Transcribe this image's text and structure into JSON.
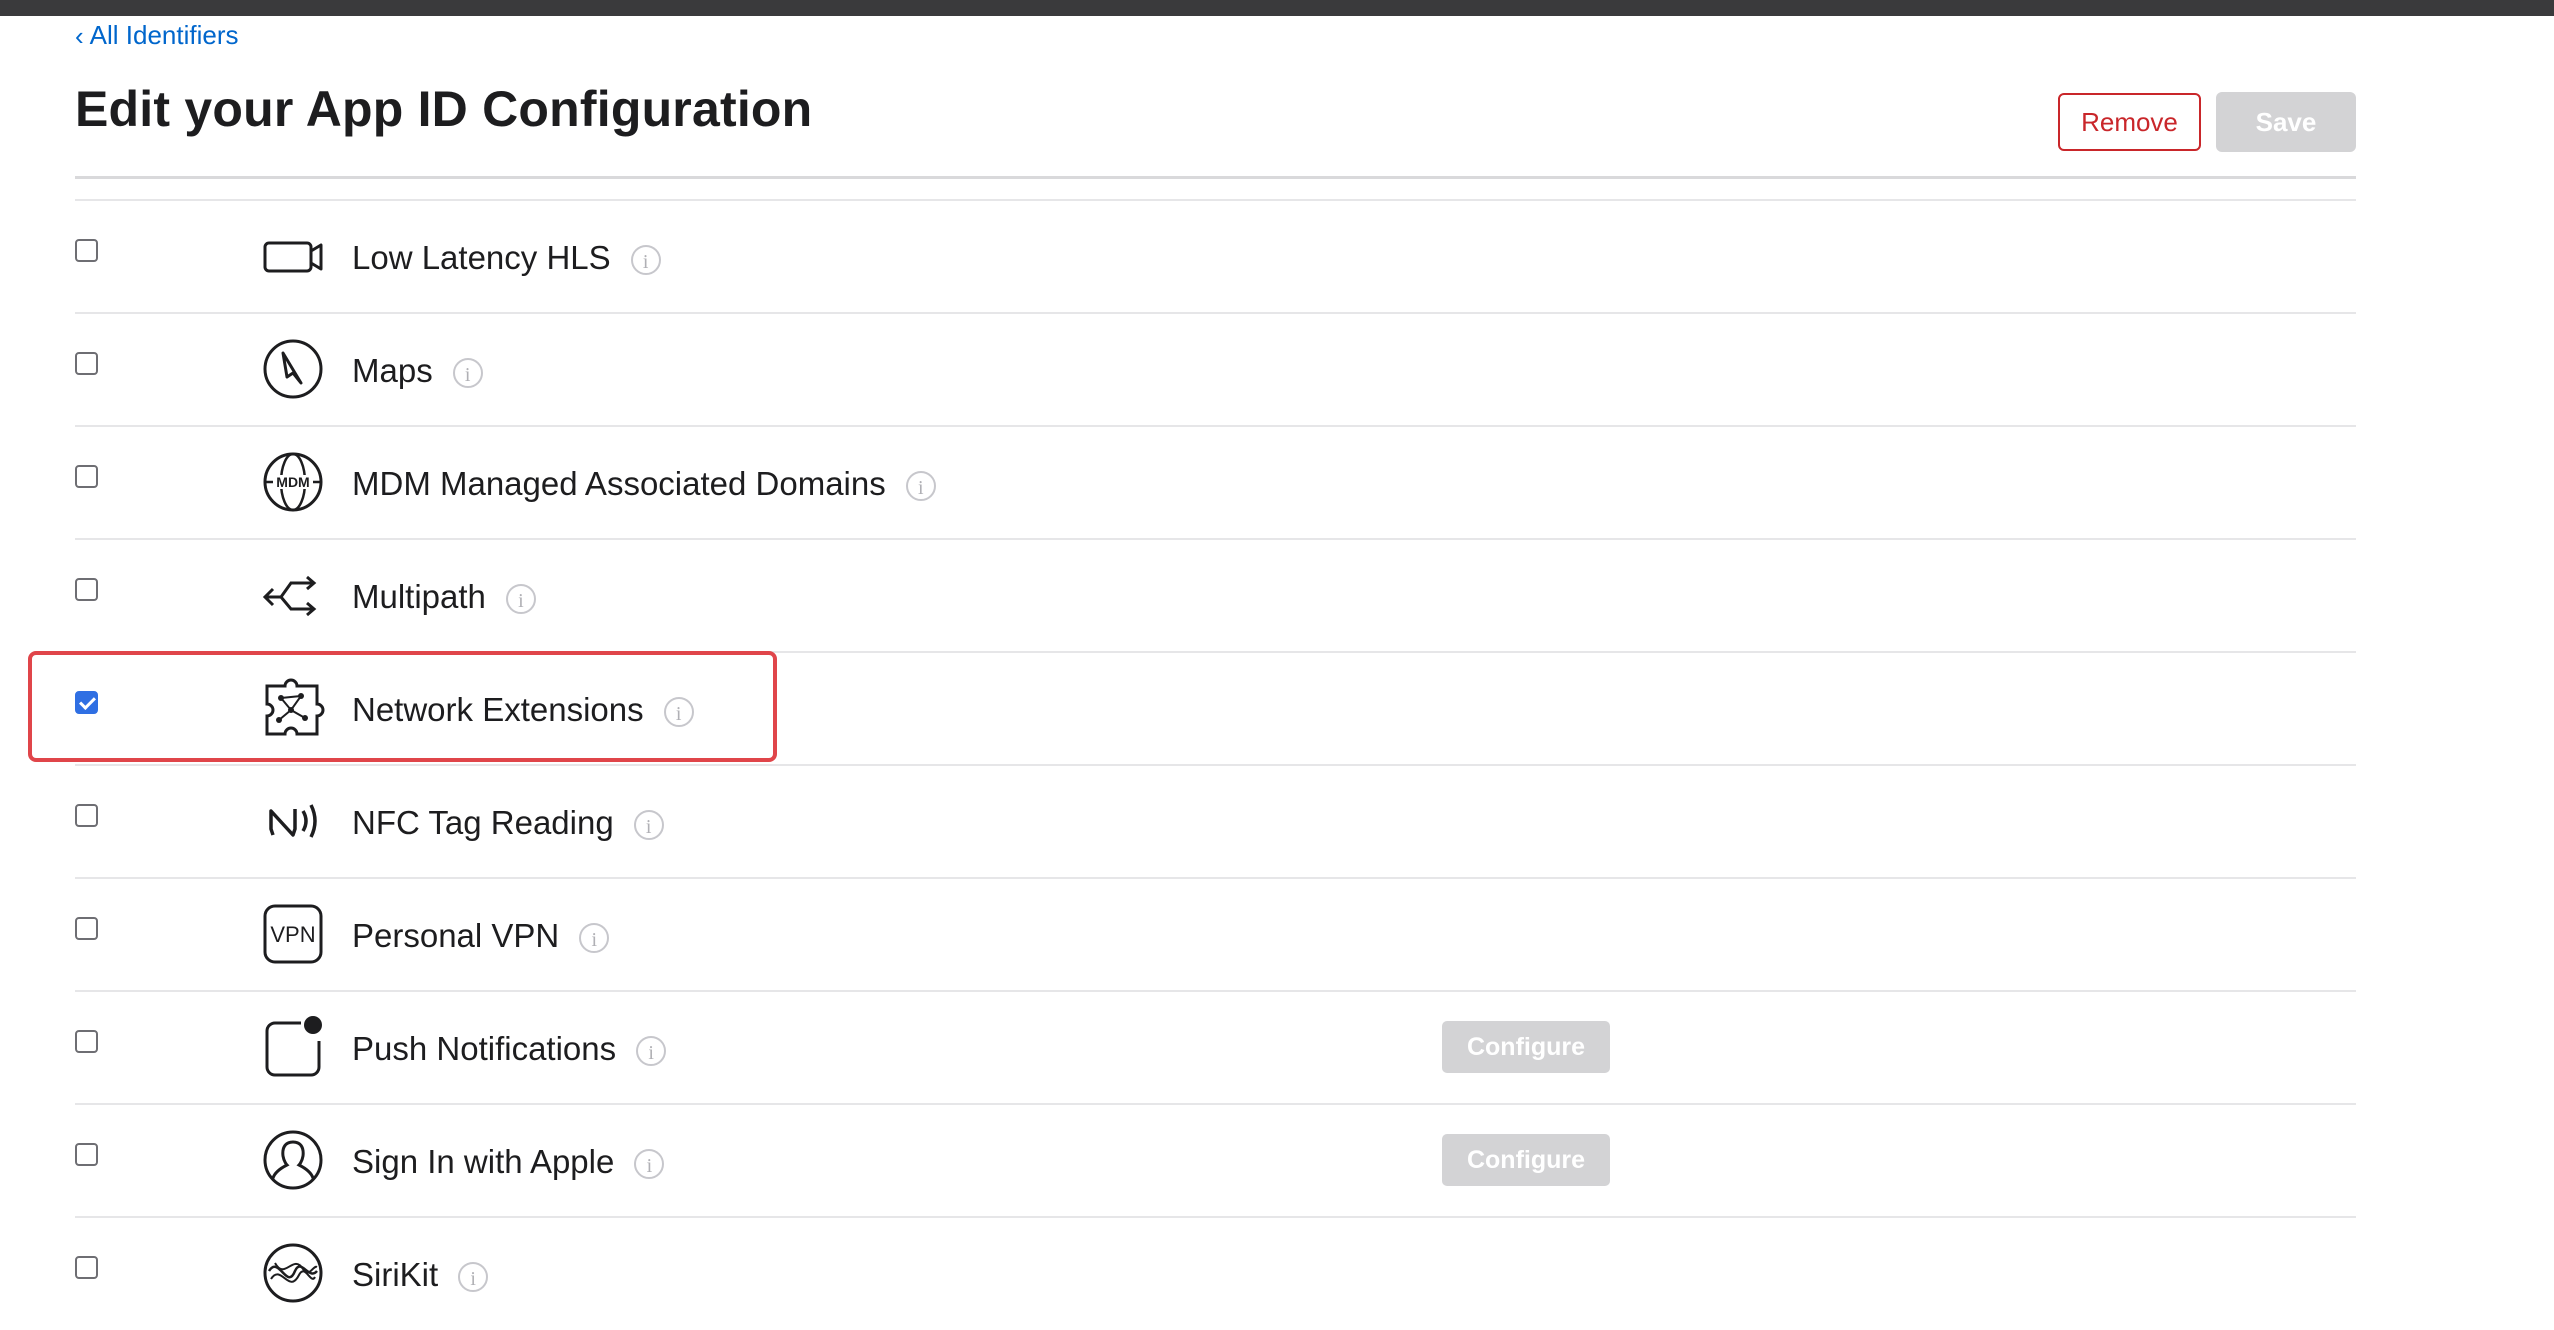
{
  "nav": {
    "back_label": "All Identifiers"
  },
  "page": {
    "title": "Edit your App ID Configuration"
  },
  "actions": {
    "remove_label": "Remove",
    "save_label": "Save"
  },
  "colors": {
    "link": "#0066cc",
    "remove": "#c9262a",
    "checked": "#2f6fe3",
    "highlight": "#e0454a",
    "disabled_button": "#d3d3d5"
  },
  "capabilities": [
    {
      "label": "Low Latency HLS",
      "checked": false,
      "icon": "video-camera-icon"
    },
    {
      "label": "Maps",
      "checked": false,
      "icon": "compass-icon"
    },
    {
      "label": "MDM Managed Associated Domains",
      "checked": false,
      "icon": "mdm-globe-icon"
    },
    {
      "label": "Multipath",
      "checked": false,
      "icon": "multipath-arrows-icon"
    },
    {
      "label": "Network Extensions",
      "checked": true,
      "icon": "network-extension-icon",
      "highlighted": true
    },
    {
      "label": "NFC Tag Reading",
      "checked": false,
      "icon": "nfc-icon"
    },
    {
      "label": "Personal VPN",
      "checked": false,
      "icon": "vpn-icon",
      "icon_text": "VPN"
    },
    {
      "label": "Push Notifications",
      "checked": false,
      "icon": "push-notification-icon",
      "configure_label": "Configure"
    },
    {
      "label": "Sign In with Apple",
      "checked": false,
      "icon": "person-circle-icon",
      "configure_label": "Configure"
    },
    {
      "label": "SiriKit",
      "checked": false,
      "icon": "siri-icon"
    }
  ],
  "info_glyph": "i",
  "mdm_icon_text": "MDM"
}
